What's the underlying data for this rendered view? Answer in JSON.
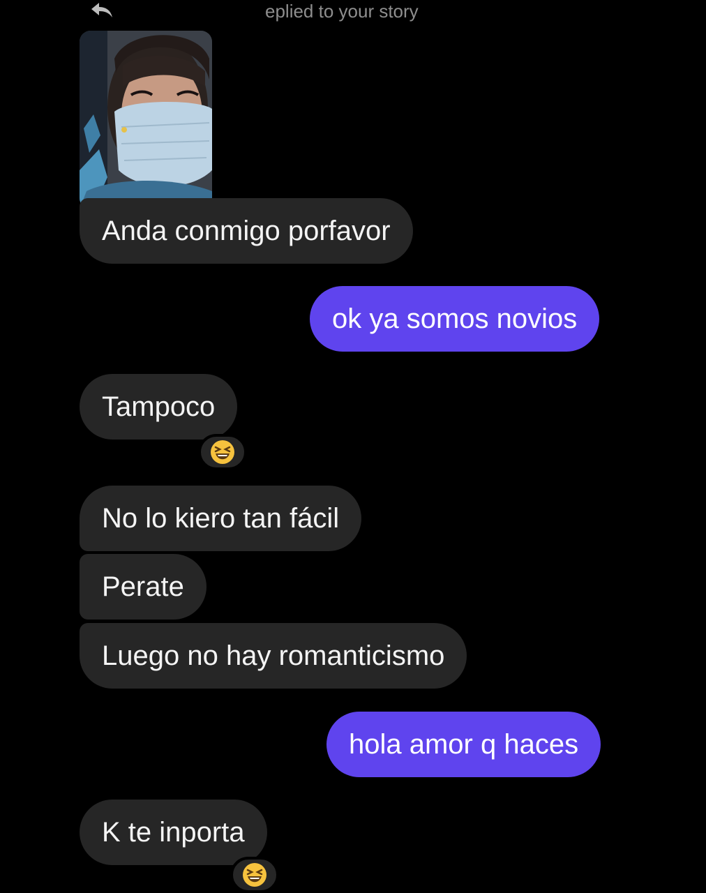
{
  "header": {
    "reply_label": "eplied to your story",
    "reply_icon": "reply-arrow-icon"
  },
  "story": {
    "thumbnail": "story-photo"
  },
  "messages": [
    {
      "from": "them",
      "text": "Anda conmigo porfavor"
    },
    {
      "from": "me",
      "text": "ok ya somos novios"
    },
    {
      "from": "them",
      "text": "Tampoco",
      "reaction": "laughing-squinting-face"
    },
    {
      "from": "them",
      "text": "No lo kiero tan fácil"
    },
    {
      "from": "them",
      "text": "Perate"
    },
    {
      "from": "them",
      "text": "Luego no hay romanticismo"
    },
    {
      "from": "me",
      "text": "hola amor q haces"
    },
    {
      "from": "them",
      "text": "K te inporta",
      "reaction": "laughing-squinting-face"
    }
  ],
  "colors": {
    "background": "#000000",
    "incoming_bubble": "#262626",
    "outgoing_bubble": "#5f44ee",
    "muted_text": "#8e8e8e"
  }
}
